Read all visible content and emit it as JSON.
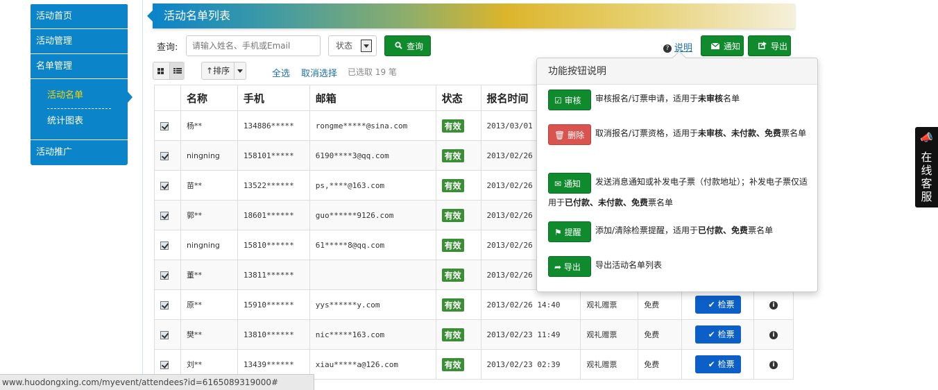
{
  "sidebar": {
    "items": [
      {
        "label": "活动首页"
      },
      {
        "label": "活动管理"
      },
      {
        "label": "名单管理"
      },
      {
        "label": "活动推广"
      }
    ],
    "sub_items": [
      {
        "label": "活动名单",
        "active": true
      },
      {
        "label": "统计图表",
        "active": false
      }
    ]
  },
  "header": {
    "title": "活动名单列表"
  },
  "toolbar": {
    "query_label": "查询:",
    "search_placeholder": "请输入姓名、手机或Email",
    "status_select": "状态",
    "query_button": "查询",
    "help_link": "说明",
    "notify_button": "通知",
    "export_button": "导出"
  },
  "toolbar2": {
    "sort_button": "排序",
    "select_all": "全选",
    "deselect": "取消选择",
    "selected_count": "已选取 19 笔"
  },
  "table": {
    "columns": [
      "名称",
      "手机",
      "邮箱",
      "状态",
      "报名时间"
    ],
    "rows": [
      {
        "name": "杨**",
        "phone": "134886*****",
        "email": "rongme*****@sina.com",
        "status": "有效",
        "time": "2013/03/01 1",
        "ticket": "",
        "price": "",
        "action": ""
      },
      {
        "name": "ningning",
        "phone": "158101*****",
        "email": "6190****3@qq.com",
        "status": "有效",
        "time": "2013/02/26 1",
        "ticket": "",
        "price": "",
        "action": ""
      },
      {
        "name": "苗**",
        "phone": "13522******",
        "email": "ps,****@163.com",
        "status": "有效",
        "time": "2013/02/26 1",
        "ticket": "",
        "price": "",
        "action": ""
      },
      {
        "name": "郭**",
        "phone": "18601******",
        "email": "guo******9126.com",
        "status": "有效",
        "time": "2013/02/26 1",
        "ticket": "",
        "price": "",
        "action": ""
      },
      {
        "name": "ningning",
        "phone": "15810******",
        "email": "61*****8@qq.com",
        "status": "有效",
        "time": "2013/02/26 1",
        "ticket": "",
        "price": "",
        "action": ""
      },
      {
        "name": "董**",
        "phone": "13811******",
        "email": "",
        "status": "有效",
        "time": "2013/02/26 1",
        "ticket": "",
        "price": "",
        "action": ""
      },
      {
        "name": "原**",
        "phone": "15910******",
        "email": "yys******y.com",
        "status": "有效",
        "time": "2013/02/26 14:40",
        "ticket": "观礼赠票",
        "price": "免费",
        "action": "检票"
      },
      {
        "name": "樊**",
        "phone": "13810******",
        "email": "nic*****163.com",
        "status": "有效",
        "time": "2013/02/23 11:49",
        "ticket": "观礼赠票",
        "price": "免费",
        "action": "检票"
      },
      {
        "name": "刘**",
        "phone": "13439******",
        "email": "xiau*****a@126.com",
        "status": "有效",
        "time": "2013/02/23 02:39",
        "ticket": "观礼赠票",
        "price": "免费",
        "action": "检票"
      }
    ]
  },
  "popover": {
    "title": "功能按钮说明",
    "items": [
      {
        "button": "审核",
        "text_pre": "审核报名/订票申请，适用于",
        "bold": "未审核",
        "text_post": "名单"
      },
      {
        "button": "删除",
        "text_pre": "取消报名/订票资格，适用于",
        "bold": "未审核、未付款、免费",
        "text_post": "票名单"
      },
      {
        "button": "通知",
        "text_pre": "发送消息通知或补发电子票（付款地址）；补发电子票仅适用于",
        "bold": "已付款、未付款、免费",
        "text_post": "票名单"
      },
      {
        "button": "提醒",
        "text_pre": "添加/清除检票提醒，适用于",
        "bold": "已付款、免费",
        "text_post": "票名单"
      },
      {
        "button": "导出",
        "text_pre": "导出活动名单列表",
        "bold": "",
        "text_post": ""
      }
    ]
  },
  "chat_widget": {
    "label": "在线客服"
  },
  "statusbar": {
    "url": "www.huodongxing.com/myevent/attendees?id=6165089319000#"
  }
}
